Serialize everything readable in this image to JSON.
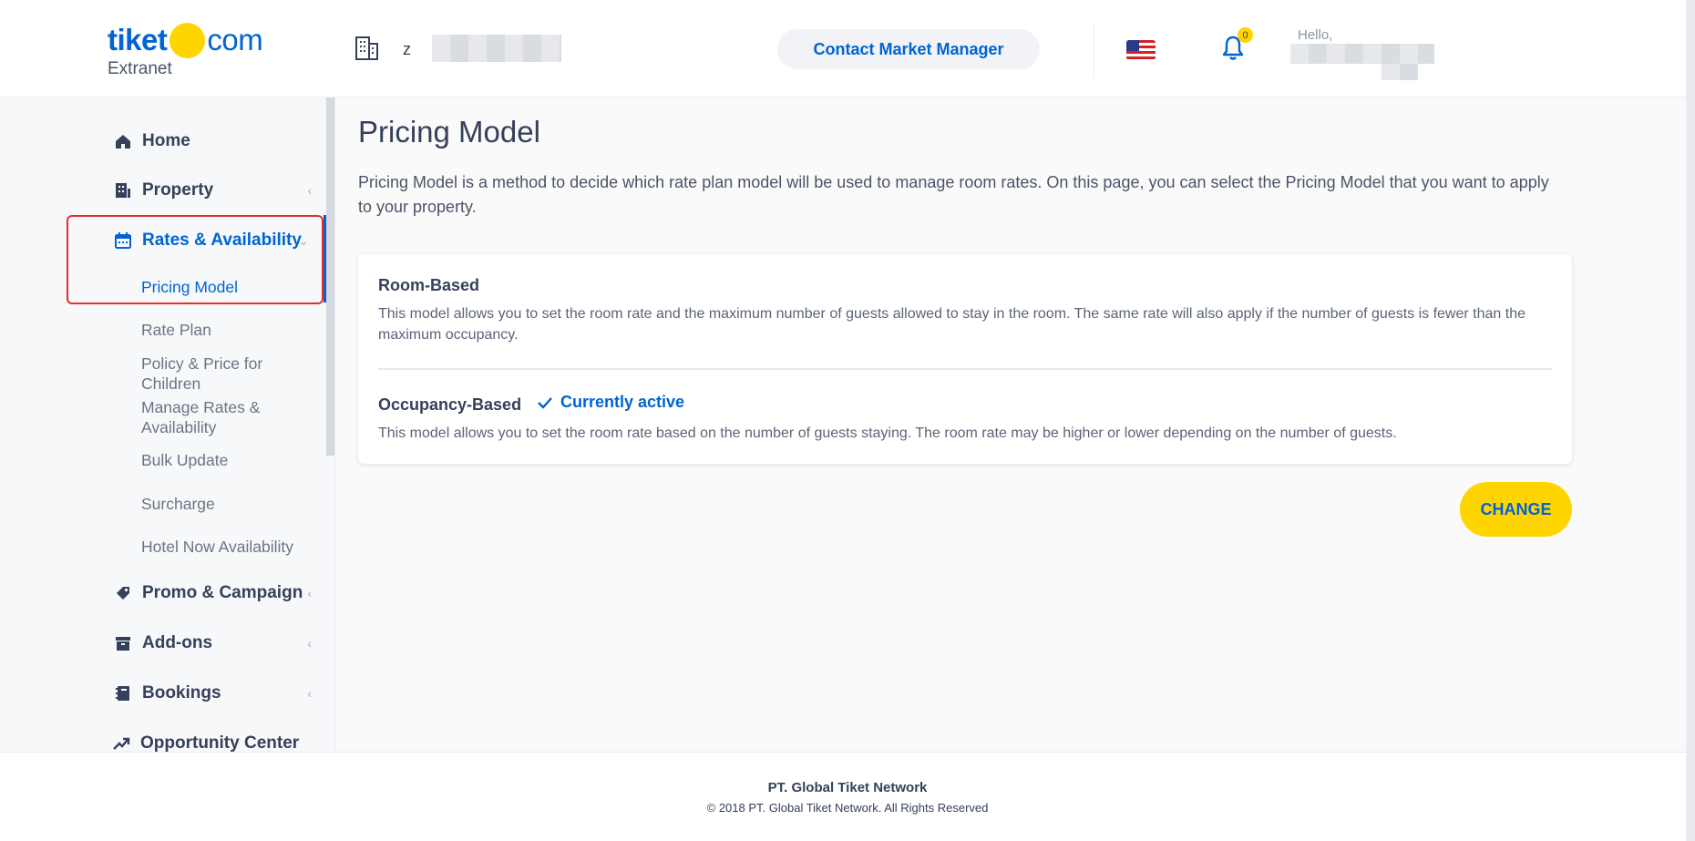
{
  "header": {
    "logo_main": "tiket",
    "logo_com": "com",
    "logo_sub": "Extranet",
    "hotel_name_initial": "z",
    "contact_button": "Contact Market Manager",
    "notification_count": "0",
    "greeting": "Hello,"
  },
  "sidebar": {
    "home": "Home",
    "property": "Property",
    "rates": "Rates & Availability",
    "sub_items": [
      "Pricing Model",
      "Rate Plan",
      "Policy & Price for Children",
      "Manage Rates & Availability",
      "Bulk Update",
      "Surcharge",
      "Hotel Now Availability"
    ],
    "promo": "Promo & Campaign",
    "addons": "Add-ons",
    "bookings": "Bookings",
    "opportunity": "Opportunity Center"
  },
  "main": {
    "title": "Pricing Model",
    "description": "Pricing Model is a method to decide which rate plan model will be used to manage room rates. On this page, you can select the Pricing Model that you want to apply to your property.",
    "room_based_title": "Room-Based",
    "room_based_desc": "This model allows you to set the room rate and the maximum number of guests allowed to stay in the room. The same rate will also apply if the number of guests is fewer than the maximum occupancy.",
    "occupancy_title": "Occupancy-Based",
    "active_label": "Currently active",
    "occupancy_desc": "This model allows you to set the room rate based on the number of guests staying. The room rate may be higher or lower depending on the number of guests.",
    "change_button": "CHANGE"
  },
  "footer": {
    "company": "PT. Global Tiket Network",
    "copyright": "© 2018 PT. Global Tiket Network. All Rights Reserved"
  },
  "colors": {
    "brand_blue": "#0064d2",
    "brand_yellow": "#ffd500",
    "highlight_red": "#e62e2e"
  }
}
